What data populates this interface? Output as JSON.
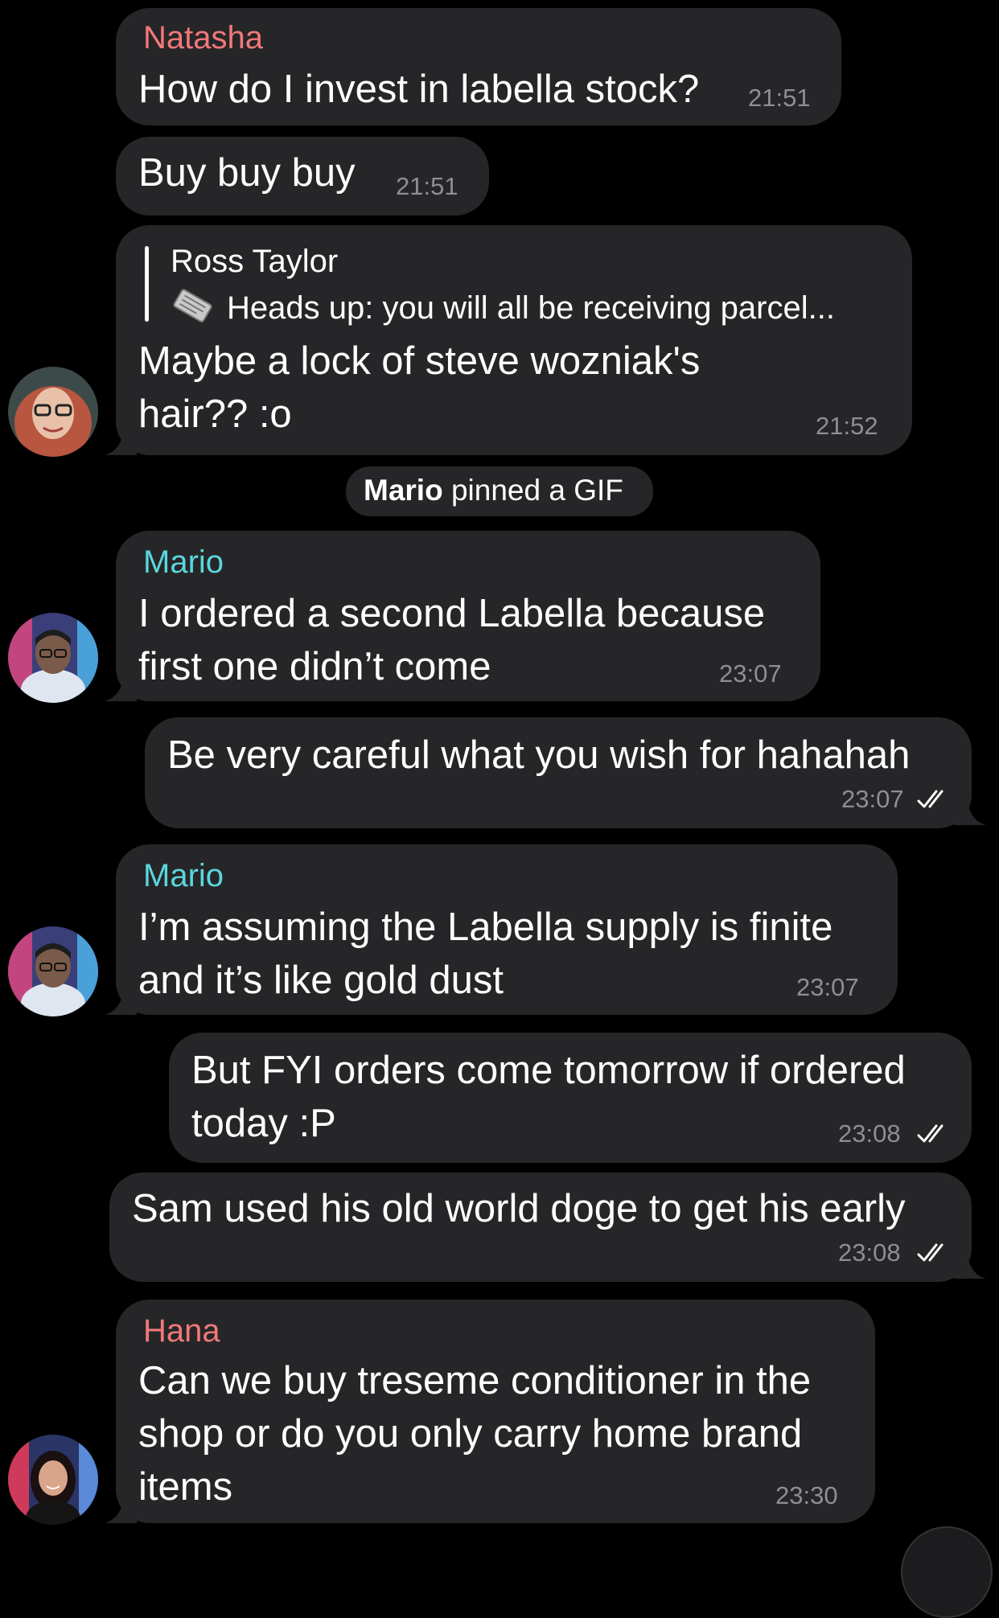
{
  "messages": [
    {
      "sender": "Natasha",
      "text": "How do I invest in labella stock?",
      "time": "21:51"
    },
    {
      "text": "Buy buy buy",
      "time": "21:51"
    },
    {
      "reply": {
        "author": "Ross Taylor",
        "snippet": "Heads up: you will all be receiving parcel..."
      },
      "line1": "Maybe a lock of steve wozniak's",
      "line2": "hair?? :o",
      "time": "21:52"
    },
    {
      "system_bold": "Mario",
      "system_rest": " pinned a GIF"
    },
    {
      "sender": "Mario",
      "line1": "I ordered a second Labella because",
      "line2": "first one didn’t come",
      "time": "23:07"
    },
    {
      "text": "Be very careful what you wish for hahahah",
      "time": "23:07"
    },
    {
      "sender": "Mario",
      "line1": "I’m assuming the Labella supply is finite",
      "line2": "and it’s like gold dust",
      "time": "23:07"
    },
    {
      "line1": "But FYI orders come tomorrow if ordered",
      "line2": "today :P",
      "time": "23:08"
    },
    {
      "text": "Sam used his old world doge to get his early",
      "time": "23:08"
    },
    {
      "sender": "Hana",
      "line1": "Can we buy treseme conditioner in the",
      "line2": "shop or do you only carry home brand",
      "line3": "items",
      "time": "23:30"
    }
  ],
  "colors": {
    "natasha": "#f2787a",
    "mario": "#5ad6dd",
    "hana": "#f2787a",
    "bubble": "#262628",
    "time": "#8e8e93"
  }
}
